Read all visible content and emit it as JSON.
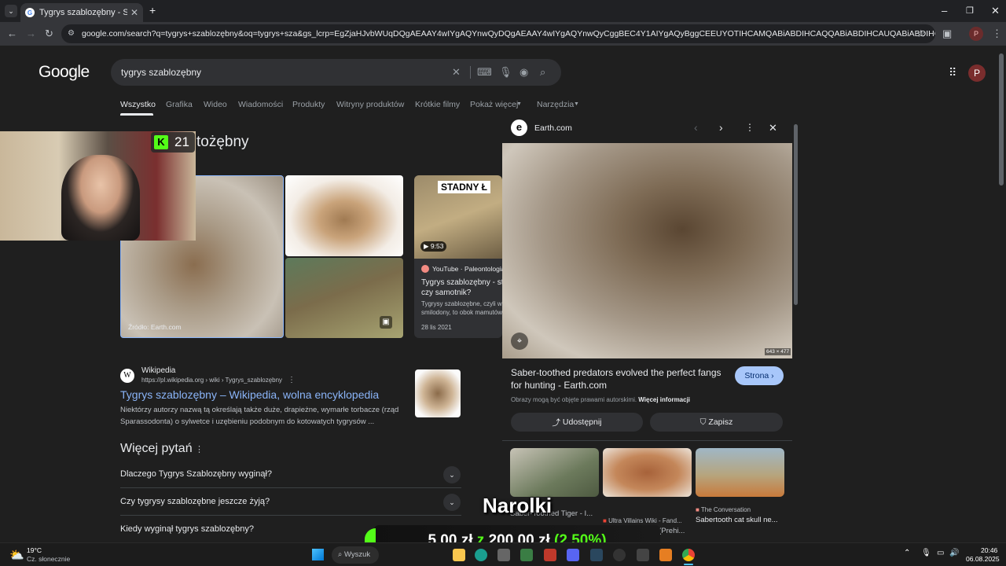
{
  "browser": {
    "tab_title": "Tygrys szablozębny - Szukaj w G",
    "tab_favicon": "G",
    "url": "google.com/search?q=tygrys+szablozębny&oq=tygrys+sza&gs_lcrp=EgZjaHJvbWUqDQgAEAAY4wIYgAQYnwQyDQgAEAAY4wIYgAQYnwQyCggBEC4Y1AIYgAQyBggCEEUYOTIHCAMQABiABDIHCAQQABiABDIHCAUQABiABDIHCAYQABiABDIHCAcQABiABDI...",
    "profile_initial": "P"
  },
  "google": {
    "logo": "Google",
    "query": "tygrys szablozębny",
    "avatar": "P",
    "tabs": [
      "Wszystko",
      "Grafika",
      "Wideo",
      "Wiadomości",
      "Produkty",
      "Witryny produktów",
      "Krótkie filmy",
      "Pokaż więcej",
      "Narzędzia"
    ],
    "heading_partial": "tożębny",
    "images": {
      "main_caption": "Źródło: Earth.com"
    },
    "youtube": {
      "badge": "STADNY Ł",
      "duration": "9:53",
      "channel": "YouTube · Paleontologia",
      "title": "Tygrys szablozębny - sta czy samotnik?",
      "snippet": "Tygrysy szablozębne, czyli w smilodony, to obok mamutów",
      "date": "28 lis 2021"
    },
    "wiki": {
      "site": "Wikipedia",
      "breadcrumb": "https://pl.wikipedia.org › wiki › Tygrys_szablozębny",
      "title": "Tygrys szablozębny – Wikipedia, wolna encyklopedia",
      "snippet": "Niektórzy autorzy nazwą tą określają także duże, drapieżne, wymarłe torbacze (rząd Sparassodonta) o sylwetce i uzębieniu podobnym do kotowatych tygrysów ..."
    },
    "paa": {
      "heading": "Więcej pytań",
      "questions": [
        "Dlaczego Tygrys Szablozębny wyginął?",
        "Czy tygrysy szablozębne jeszcze żyją?",
        "Kiedy wyginął tygrys szablozębny?"
      ]
    }
  },
  "panel": {
    "source": "Earth.com",
    "source_icon": "e",
    "dims": "643 × 477",
    "title": "Saber-toothed predators evolved the perfect fangs for hunting - Earth.com",
    "visit_label": "Strona",
    "copyright": "Obrazy mogą być objęte prawami autorskimi.",
    "more_info": "Więcej informacji",
    "share_label": "Udostępnij",
    "save_label": "Zapisz",
    "related": [
      {
        "source": "",
        "title": "Saber-Toothed Tiger - I..."
      },
      {
        "source": "Ultra Villains Wiki - Fand...",
        "title": "Saber Tooth Cat (Prehi..."
      },
      {
        "source": "The Conversation",
        "title": "Sabertooth cat skull ne..."
      }
    ]
  },
  "overlay": {
    "kick_count": "21",
    "narolki": "Narolki",
    "donation_a": "5,00 zł",
    "donation_z": "z",
    "donation_b": "200,00 zł",
    "donation_pct": "(2.50%)"
  },
  "taskbar": {
    "weather_temp": "19°C",
    "weather_desc": "Cz. słonecznie",
    "search_label": "Wyszuk",
    "time": "20:46",
    "date": "06.08.2025"
  },
  "colors": {
    "accent_blue": "#8ab4f8",
    "donation_green": "#53fc18",
    "visit_button": "#a8c7fa"
  }
}
